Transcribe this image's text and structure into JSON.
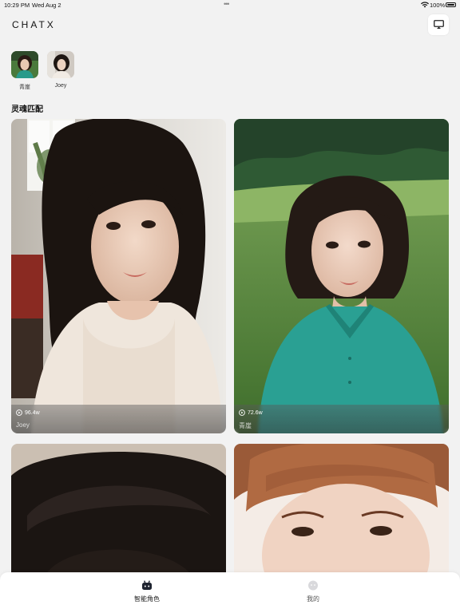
{
  "status_bar": {
    "time": "10:29 PM",
    "date": "Wed Aug 2",
    "battery": "100%"
  },
  "header": {
    "logo": "CHATX",
    "cast_icon": "screen-cast-icon"
  },
  "recent": [
    {
      "name": "青崖"
    },
    {
      "name": "Joey"
    }
  ],
  "section_title": "灵魂匹配",
  "cards": [
    {
      "views": "96.4w",
      "name": "Joey"
    },
    {
      "views": "72.6w",
      "name": "青崖"
    }
  ],
  "tabs": [
    {
      "label": "智能角色",
      "icon": "robot-icon",
      "active": true
    },
    {
      "label": "我的",
      "icon": "profile-icon",
      "active": false
    }
  ],
  "colors": {
    "background": "#f2f2f2",
    "tab_bar": "#ffffff",
    "active_tab_icon": "#1f2430"
  }
}
